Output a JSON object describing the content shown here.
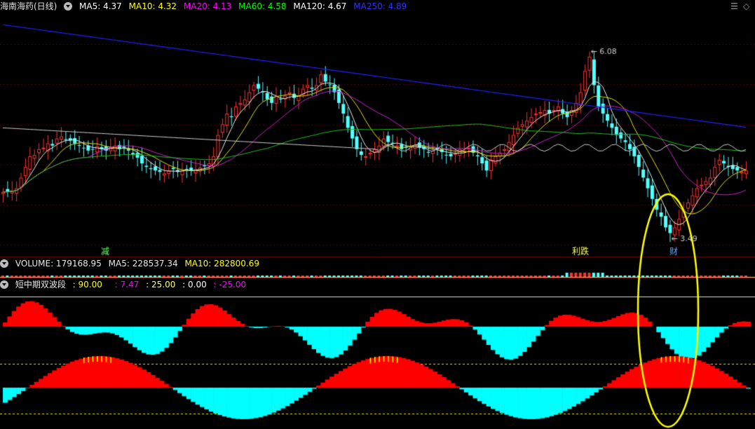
{
  "colors": {
    "bg": "#000000",
    "up": "#ff3232",
    "down": "#54ffff",
    "ma5": "#ffffff",
    "ma10": "#ffff00",
    "ma20": "#ff00ff",
    "ma60": "#00ff00",
    "ma120": "#ffffff",
    "ma250": "#0000ff",
    "divider": "#6a0000",
    "grid": "#5a0000",
    "red_fill": "#ff0000",
    "cyan_fill": "#00ffff",
    "highlight": "#ffff00"
  },
  "header": {
    "title": "海南海药(日线)",
    "ma5": "MA5: 4.37",
    "ma10": "MA10: 4.32",
    "ma20": "MA20: 4.13",
    "ma60": "MA60: 4.58",
    "ma120": "MA120: 4.67",
    "ma250": "MA250: 4.89"
  },
  "volume_header": {
    "title": "VOLUME: 179168.95",
    "ma5": "MA5: 228537.34",
    "ma10": "MA10: 282800.69"
  },
  "indicator_header": {
    "title": "短中期双波段",
    "v1": ": 90.00",
    "v2": ": 7.47",
    "v3": ": 25.00",
    "v4": ": 0.00",
    "v5": ": -25.00"
  },
  "chart_data": {
    "type": "candlestick",
    "price_range": [
      3.2,
      6.6
    ],
    "high_marker": "6.08",
    "low_marker": "3.49",
    "markers": [
      "减",
      "利跌",
      "财"
    ],
    "closes": [
      4.1,
      4.1,
      4.12,
      4.15,
      4.3,
      4.45,
      4.6,
      4.62,
      4.7,
      4.72,
      4.78,
      4.75,
      4.85,
      4.88,
      4.84,
      4.82,
      4.78,
      4.75,
      4.72,
      4.68,
      4.7,
      4.74,
      4.7,
      4.68,
      4.72,
      4.75,
      4.7,
      4.72,
      4.68,
      4.62,
      4.58,
      4.5,
      4.45,
      4.42,
      4.4,
      4.38,
      4.36,
      4.4,
      4.42,
      4.38,
      4.4,
      4.41,
      4.4,
      4.42,
      4.44,
      4.46,
      4.5,
      4.6,
      4.9,
      5.05,
      5.2,
      5.15,
      5.3,
      5.35,
      5.4,
      5.5,
      5.6,
      5.55,
      5.5,
      5.4,
      5.35,
      5.45,
      5.4,
      5.45,
      5.5,
      5.42,
      5.45,
      5.55,
      5.6,
      5.55,
      5.6,
      5.75,
      5.65,
      5.6,
      5.5,
      5.35,
      5.2,
      5.0,
      4.85,
      4.7,
      4.62,
      4.6,
      4.65,
      4.7,
      4.75,
      4.85,
      4.8,
      4.78,
      4.75,
      4.7,
      4.72,
      4.74,
      4.76,
      4.72,
      4.7,
      4.65,
      4.68,
      4.7,
      4.66,
      4.62,
      4.6,
      4.64,
      4.7,
      4.68,
      4.72,
      4.65,
      4.6,
      4.5,
      4.4,
      4.55,
      4.6,
      4.65,
      4.7,
      4.8,
      4.9,
      5.0,
      5.05,
      5.1,
      5.15,
      5.2,
      5.22,
      5.25,
      5.2,
      5.25,
      5.3,
      5.2,
      5.15,
      5.25,
      5.35,
      5.5,
      5.8,
      6.0,
      5.6,
      5.3,
      5.2,
      5.1,
      5.0,
      4.9,
      4.85,
      4.8,
      4.7,
      4.6,
      4.45,
      4.3,
      4.15,
      4.0,
      3.85,
      3.75,
      3.6,
      3.52,
      3.6,
      3.72,
      3.85,
      3.95,
      4.05,
      4.15,
      4.2,
      4.25,
      4.3,
      4.45,
      4.55,
      4.5,
      4.45,
      4.42,
      4.4,
      4.38,
      4.4
    ]
  }
}
